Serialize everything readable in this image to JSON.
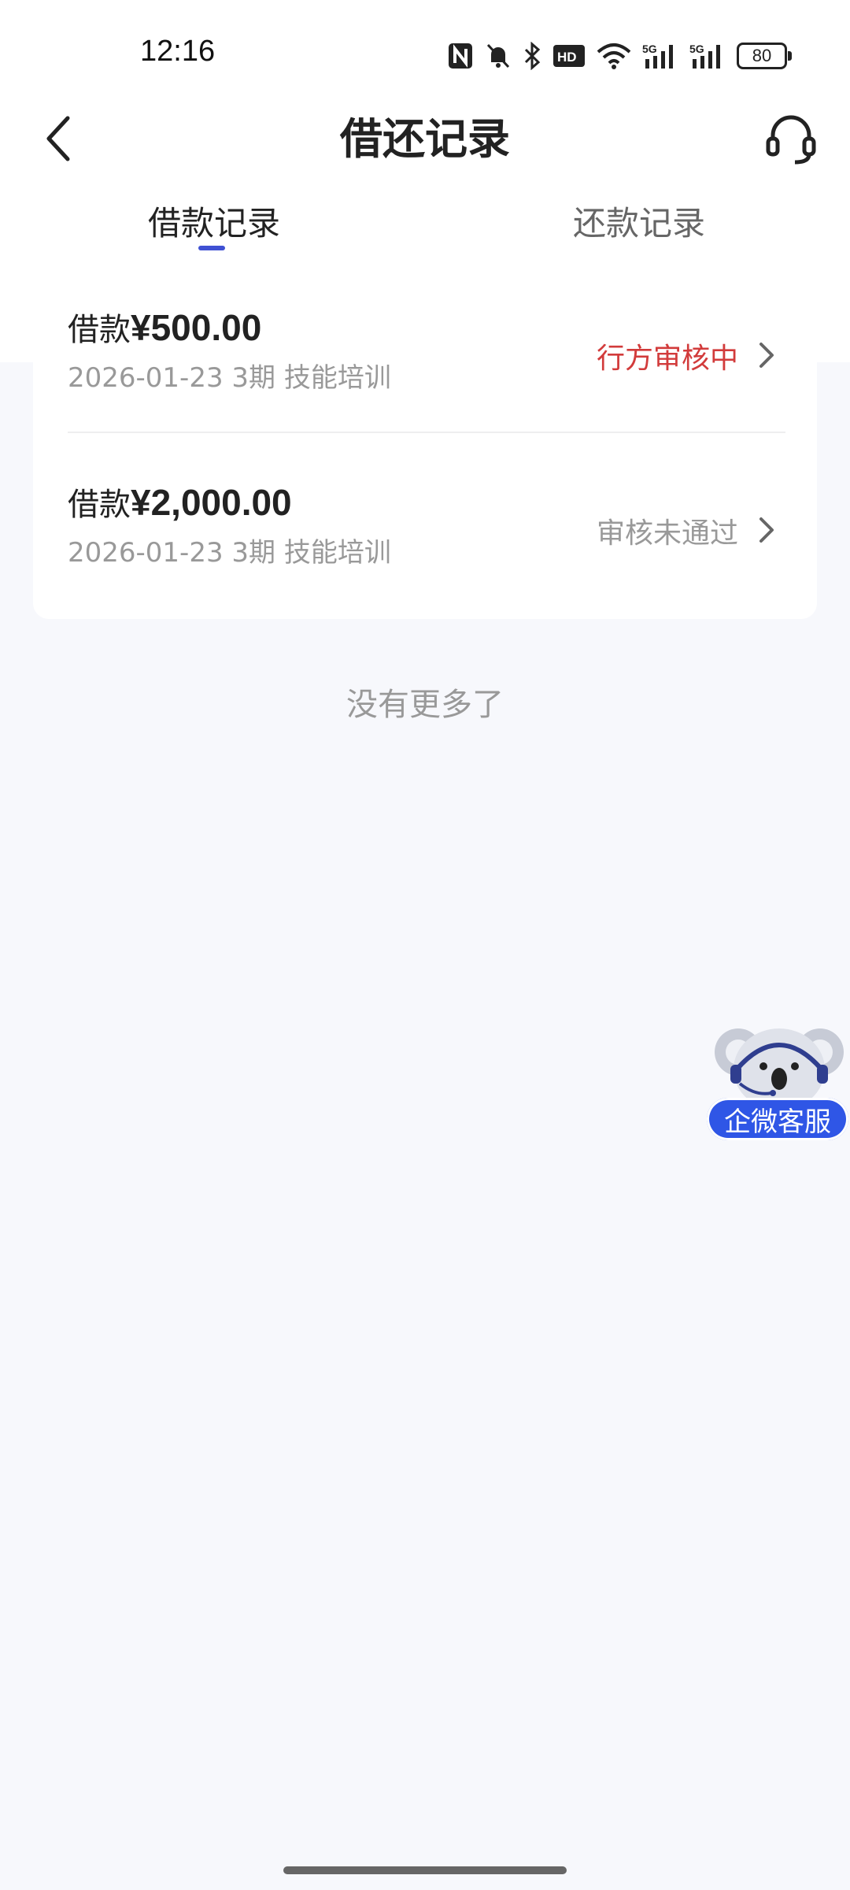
{
  "status_bar": {
    "time": "12:16",
    "battery": "80",
    "icons": [
      "nfc-icon",
      "silent-bell-icon",
      "bluetooth-icon",
      "hd-icon",
      "wifi-icon",
      "5g-signal-icon",
      "5g-signal-icon-2",
      "battery-icon"
    ]
  },
  "header": {
    "title": "借还记录",
    "back_icon": "chevron-left-icon",
    "service_icon": "headset-icon"
  },
  "tabs": [
    {
      "label": "借款记录",
      "active": true
    },
    {
      "label": "还款记录",
      "active": false
    }
  ],
  "records": [
    {
      "prefix": "借款",
      "amount": "¥500.00",
      "date": "2026-01-23",
      "term": "3期",
      "purpose": "技能培训",
      "status": "行方审核中",
      "status_color": "#d23b3b"
    },
    {
      "prefix": "借款",
      "amount": "¥2,000.00",
      "date": "2026-01-23",
      "term": "3期",
      "purpose": "技能培训",
      "status": "审核未通过",
      "status_color": "#999999"
    }
  ],
  "footer_text": "没有更多了",
  "floating_service": {
    "label": "企微客服"
  }
}
